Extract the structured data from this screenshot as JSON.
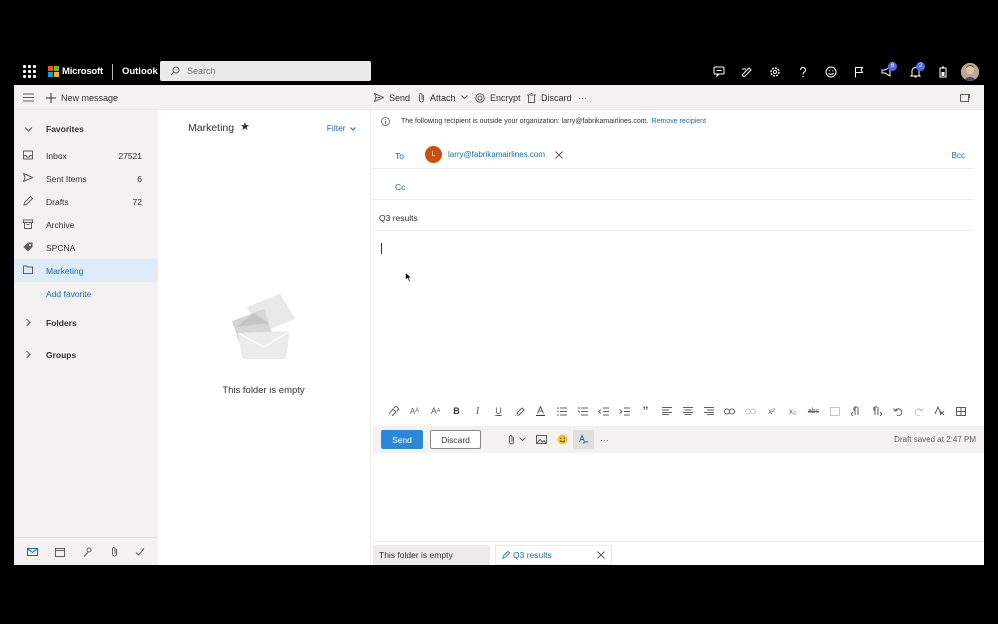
{
  "topbar": {
    "brand": "Microsoft",
    "app_name": "Outlook",
    "search_placeholder": "Search",
    "badges": {
      "notifications_a": "6",
      "notifications_b": "2"
    }
  },
  "command_bar": {
    "new_message": "New message",
    "send": "Send",
    "attach": "Attach",
    "encrypt": "Encrypt",
    "discard": "Discard",
    "more": "···"
  },
  "nav": {
    "favorites": "Favorites",
    "items": [
      {
        "label": "Inbox",
        "count": "27521",
        "icon": "inbox-icon"
      },
      {
        "label": "Sent Items",
        "count": "6",
        "icon": "send-icon"
      },
      {
        "label": "Drafts",
        "count": "72",
        "icon": "pencil-icon"
      },
      {
        "label": "Archive",
        "count": "",
        "icon": "archive-icon"
      },
      {
        "label": "SPCNA",
        "count": "",
        "icon": "tag-icon"
      },
      {
        "label": "Marketing",
        "count": "",
        "icon": "folder-icon"
      }
    ],
    "add_favorite": "Add favorite",
    "folders": "Folders",
    "groups": "Groups"
  },
  "message_list": {
    "folder_title": "Marketing",
    "star": "★",
    "filter": "Filter",
    "empty_text": "This folder is empty"
  },
  "compose": {
    "warning_text": "The following recipient is outside your organization: larry@fabrikamairlines.com.",
    "remove_recipient": "Remove recipient",
    "to_label": "To",
    "recipient_initial": "L",
    "recipient_email": "larry@fabrikamairlines.com",
    "bcc": "Bcc",
    "cc_label": "Cc",
    "subject": "Q3 results",
    "send": "Send",
    "discard": "Discard",
    "more": "···",
    "draft_saved": "Draft saved at 2:47 PM"
  },
  "format_toolbar": {
    "bold": "B",
    "italic": "I",
    "underline": "U",
    "quote": "”",
    "superscript": "x²",
    "subscript": "x₂"
  },
  "tabs": {
    "tab1": "This folder is empty",
    "tab2": "Q3 results"
  },
  "colors": {
    "accent": "#0f6cbd",
    "send_button": "#2b88d8",
    "selected_nav": "#deecf9",
    "recipient_avatar": "#ca5010"
  }
}
